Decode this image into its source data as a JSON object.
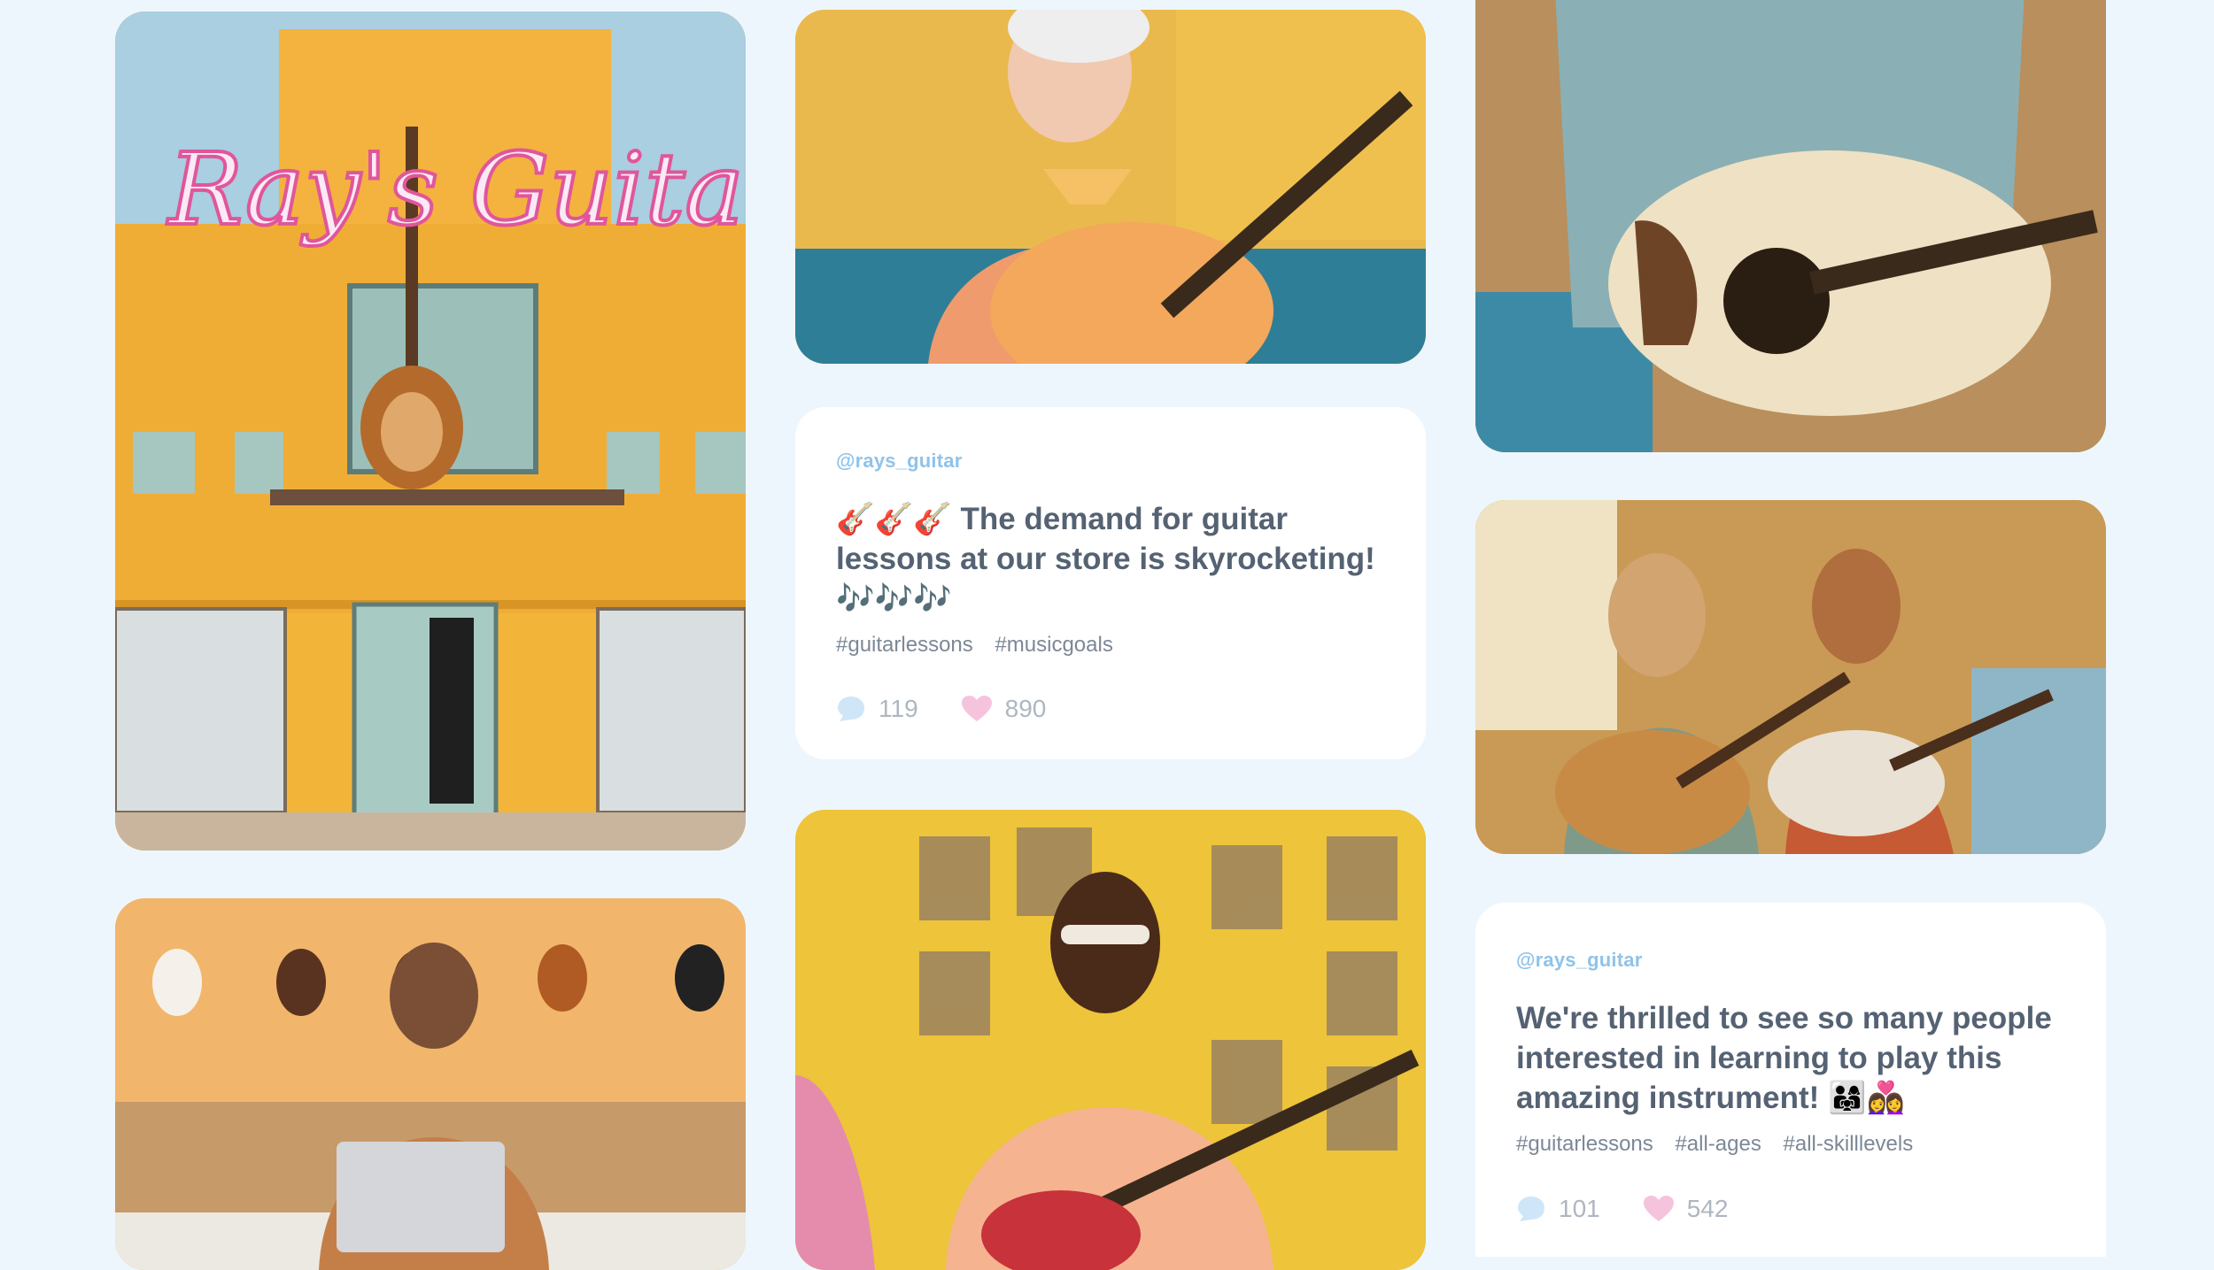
{
  "storefront": {
    "sign_text": "Ray's Guitar"
  },
  "post1": {
    "handle": "@rays_guitar",
    "emoji_prefix": "🎸🎸🎸",
    "text": "The demand for guitar lessons at our store is skyrocketing!",
    "emoji_suffix": "🎶🎶🎶",
    "tags": [
      "#guitarlessons",
      "#musicgoals"
    ],
    "comments": "119",
    "likes": "890"
  },
  "post2": {
    "handle": "@rays_guitar",
    "text": "We're thrilled to see so many people interested in learning to play this amazing instrument!",
    "emoji_suffix": "👨‍👩‍👧👩‍❤️‍👩",
    "tags": [
      "#guitarlessons",
      "#all-ages",
      "#all-skilllevels"
    ],
    "comments": "101",
    "likes": "542"
  },
  "colors": {
    "background": "#eef6fd",
    "handle": "#8fc3ea",
    "post_text": "#556273",
    "comment_icon": "#cfe6f8",
    "heart_icon": "#f6c3dd"
  }
}
